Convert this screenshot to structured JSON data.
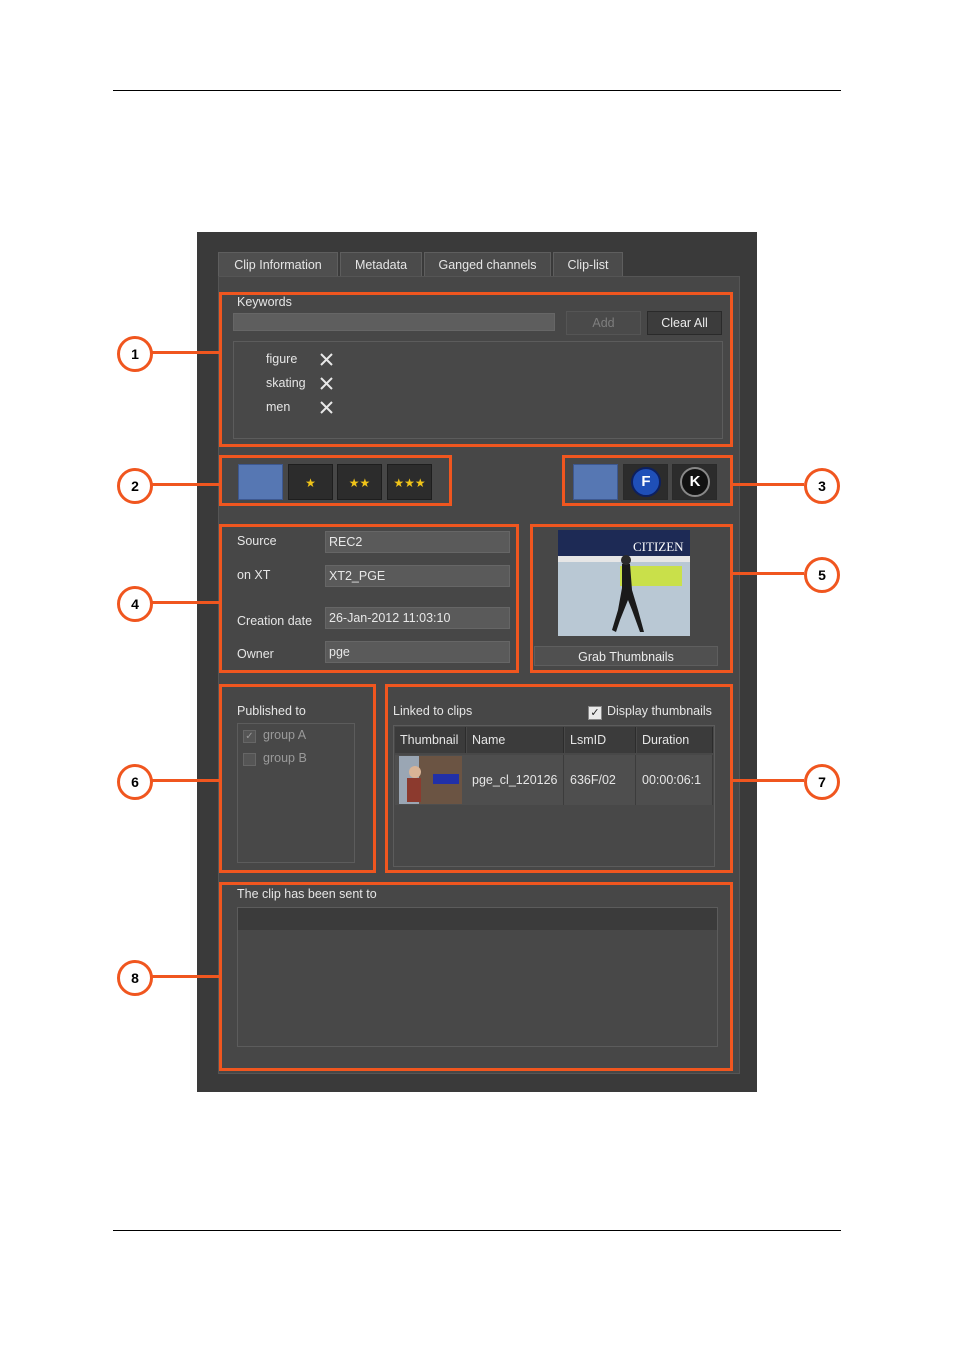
{
  "tabs": [
    "Clip Information",
    "Metadata",
    "Ganged channels",
    "Clip-list"
  ],
  "keywords": {
    "label": "Keywords",
    "add_label": "Add",
    "clear_label": "Clear All",
    "items": [
      "figure",
      "skating",
      "men"
    ]
  },
  "rating": {
    "stars": [
      "★",
      "★★",
      "★★★"
    ]
  },
  "flags": {
    "f_label": "F",
    "k_label": "K"
  },
  "source_info": {
    "source_label": "Source",
    "source_value": "REC2",
    "onxt_label": "on XT",
    "onxt_value": "XT2_PGE",
    "creation_label": "Creation date",
    "creation_value": "26-Jan-2012 11:03:10",
    "owner_label": "Owner",
    "owner_value": "pge"
  },
  "thumbnail": {
    "grab_label": "Grab Thumbnails",
    "banner_text": "CITIZEN"
  },
  "published": {
    "label": "Published to",
    "groups": [
      {
        "name": "group A",
        "checked": true
      },
      {
        "name": "group B",
        "checked": false
      }
    ]
  },
  "linked": {
    "label": "Linked to clips",
    "display_thumbnails_label": "Display thumbnails",
    "display_thumbnails_checked": true,
    "columns": [
      "Thumbnail",
      "Name",
      "LsmID",
      "Duration"
    ],
    "rows": [
      {
        "name": "pge_cl_120126",
        "lsmid": "636F/02",
        "duration": "00:00:06:1"
      }
    ]
  },
  "sent": {
    "label": "The clip has been sent to"
  },
  "callouts": [
    "1",
    "2",
    "3",
    "4",
    "5",
    "6",
    "7",
    "8"
  ],
  "colors": {
    "highlight": "#f0561f",
    "panel": "#3a3a3a",
    "rating_selected": "#5677b3",
    "star": "#f0c419"
  }
}
